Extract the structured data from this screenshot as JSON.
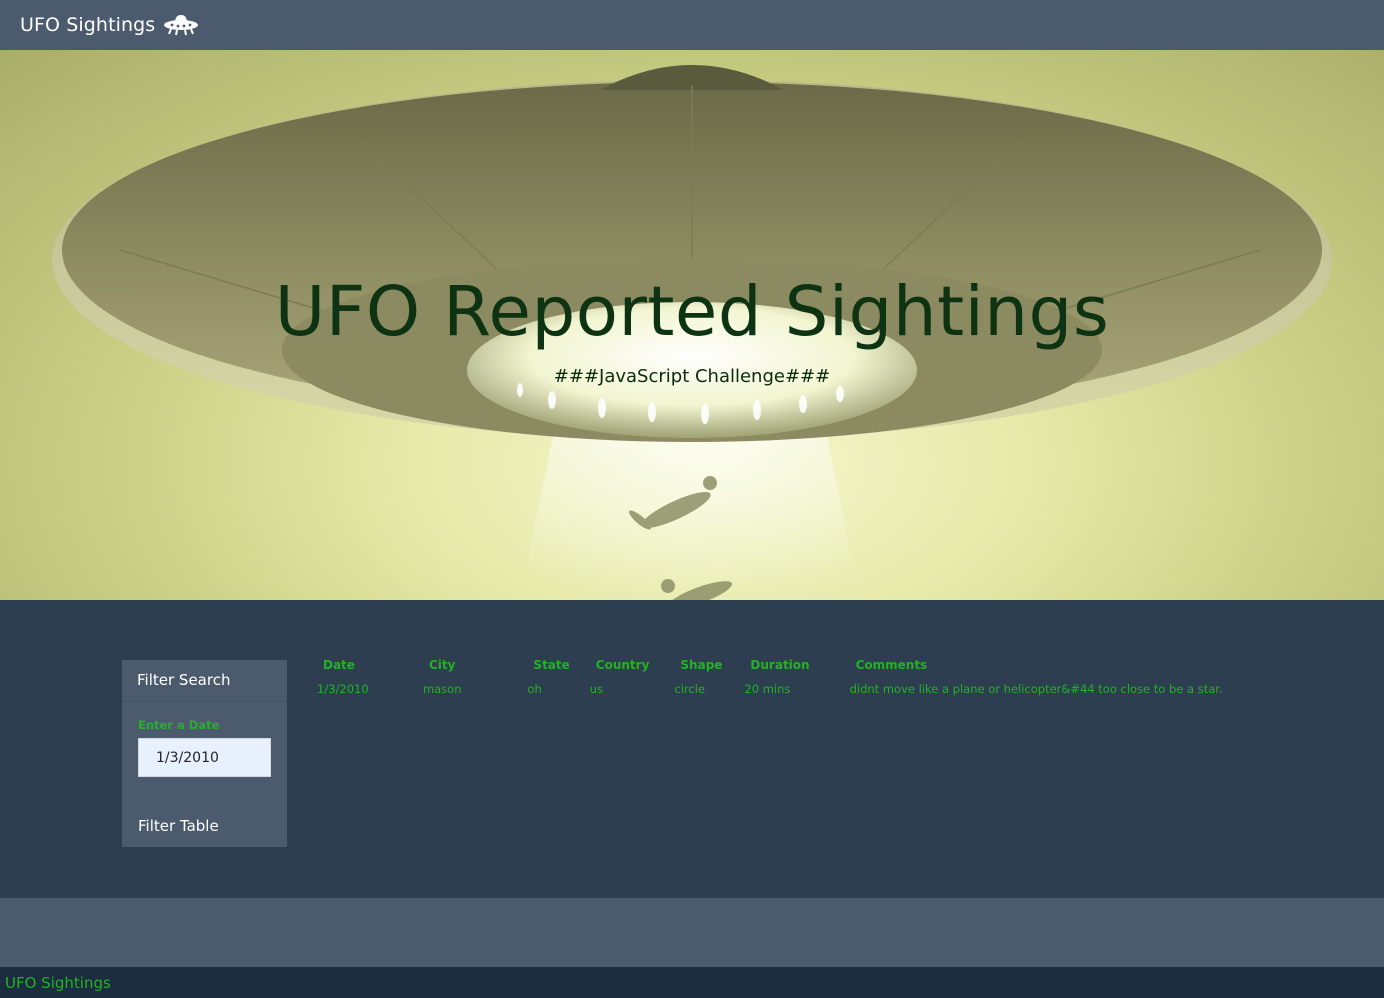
{
  "navbar": {
    "brand": "UFO Sightings",
    "icon": "ufo-icon"
  },
  "hero": {
    "title": "UFO Reported Sightings",
    "subtitle": "###JavaScript Challenge###"
  },
  "filter": {
    "header": "Filter Search",
    "label": "Enter a Date",
    "input_value": "1/3/2010",
    "button_label": "Filter Table"
  },
  "table": {
    "columns": [
      "Date",
      "City",
      "State",
      "Country",
      "Shape",
      "Duration",
      "Comments"
    ],
    "rows": [
      [
        "1/3/2010",
        "mason",
        "oh",
        "us",
        "circle",
        "20 mins",
        "didnt move like a plane or helicopter&#44 too close to be a star."
      ]
    ]
  },
  "footer": {
    "text": "UFO Sightings"
  },
  "colors": {
    "navbar": "#4b5b6d",
    "main_bg": "#2c3e50",
    "accent_green": "#21b321",
    "footer_bg": "#1c2d40"
  }
}
